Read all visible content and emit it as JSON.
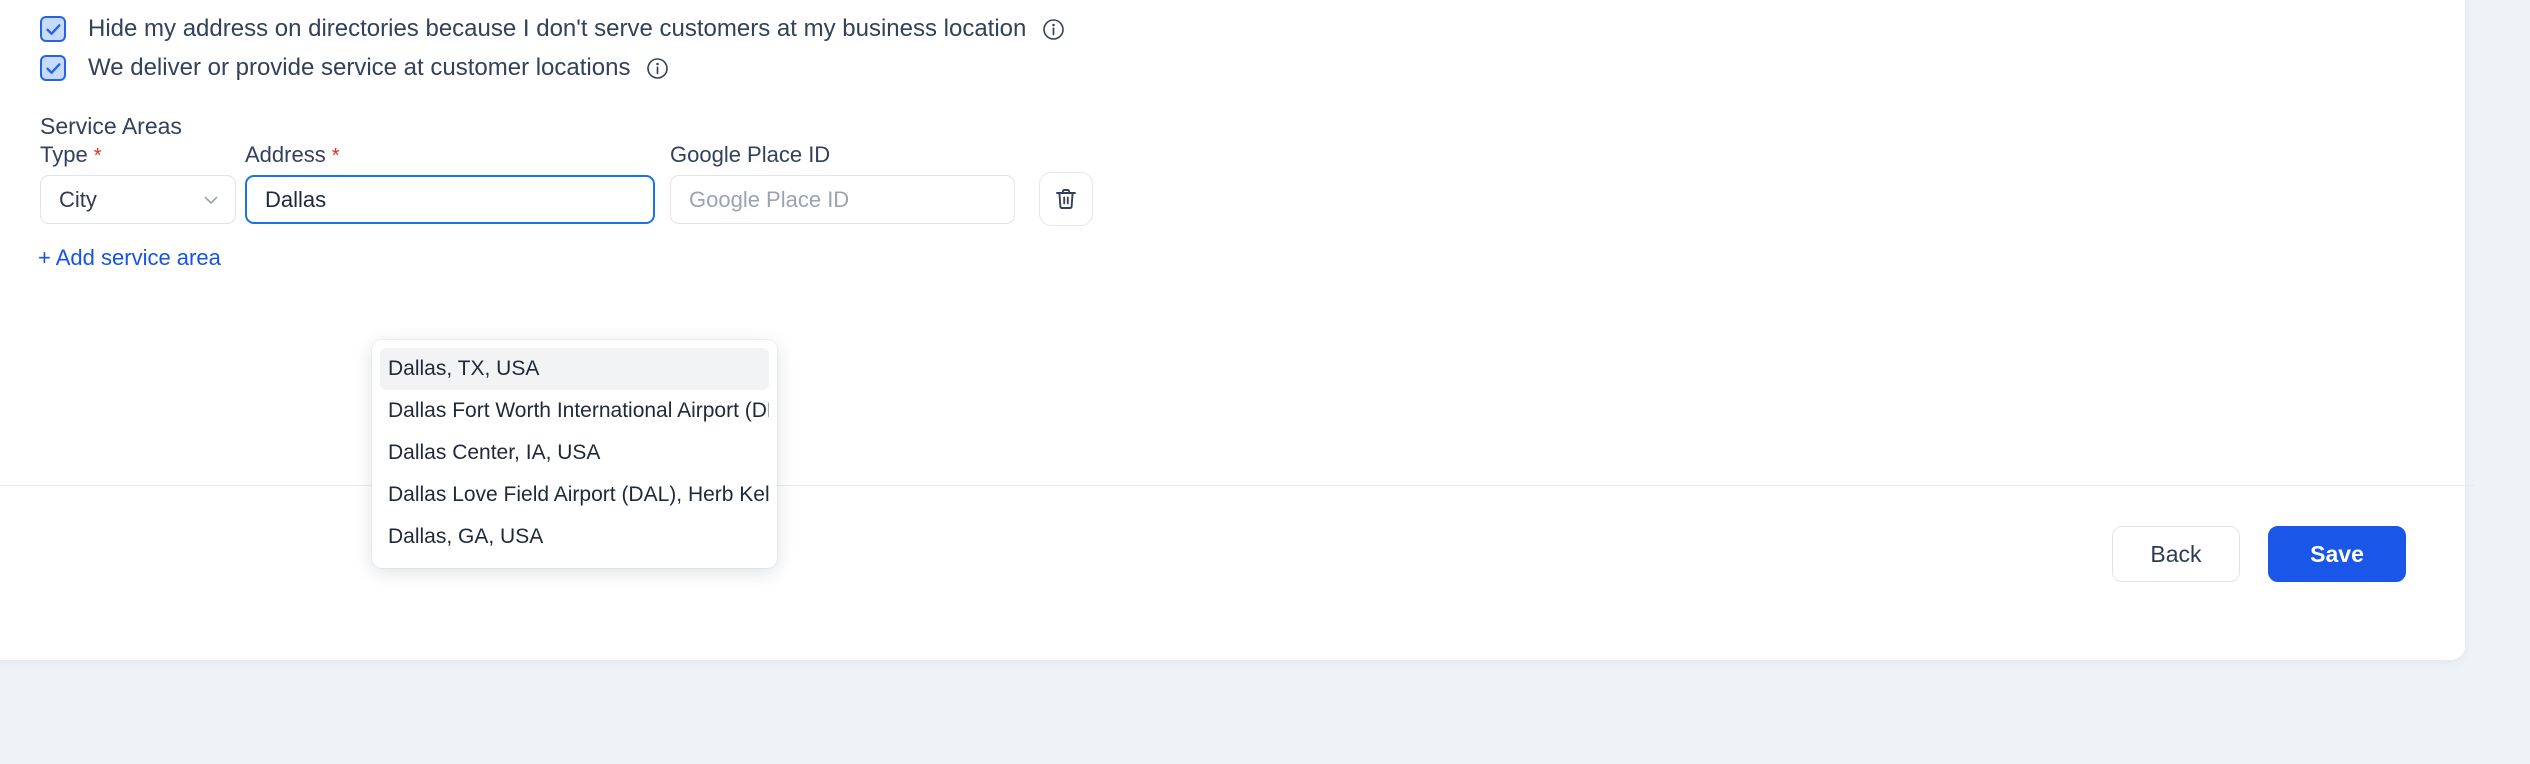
{
  "checkboxes": [
    {
      "label": "Hide my address on directories because I don't serve customers at my business location",
      "checked": true,
      "info": "info-icon"
    },
    {
      "label": "We deliver or provide service at customer locations",
      "checked": true,
      "info": "info-icon"
    }
  ],
  "service_areas": {
    "section_title": "Service Areas",
    "labels": {
      "type": "Type",
      "address": "Address",
      "place_id": "Google Place ID",
      "required_mark": "*"
    },
    "row": {
      "type_value": "City",
      "address_value": "Dallas",
      "place_id_value": "",
      "place_id_placeholder": "Google Place ID",
      "delete_icon": "trash-icon"
    },
    "add_link": "+ Add service area"
  },
  "autocomplete": {
    "suggestions": [
      {
        "text": "Dallas, TX, USA",
        "highlighted": true
      },
      {
        "text": "Dallas Fort Worth International Airport (DF…",
        "highlighted": false
      },
      {
        "text": "Dallas Center, IA, USA",
        "highlighted": false
      },
      {
        "text": "Dallas Love Field Airport (DAL), Herb Kelleh…",
        "highlighted": false
      },
      {
        "text": "Dallas, GA, USA",
        "highlighted": false
      }
    ]
  },
  "footer": {
    "back_label": "Back",
    "save_label": "Save"
  },
  "colors": {
    "accent_blue": "#1a56e8",
    "link_blue": "#1653e8",
    "focus_blue": "#1a73e8",
    "required_red": "#d93025",
    "text_dark": "#33415c",
    "page_bg": "#eef3f7"
  }
}
